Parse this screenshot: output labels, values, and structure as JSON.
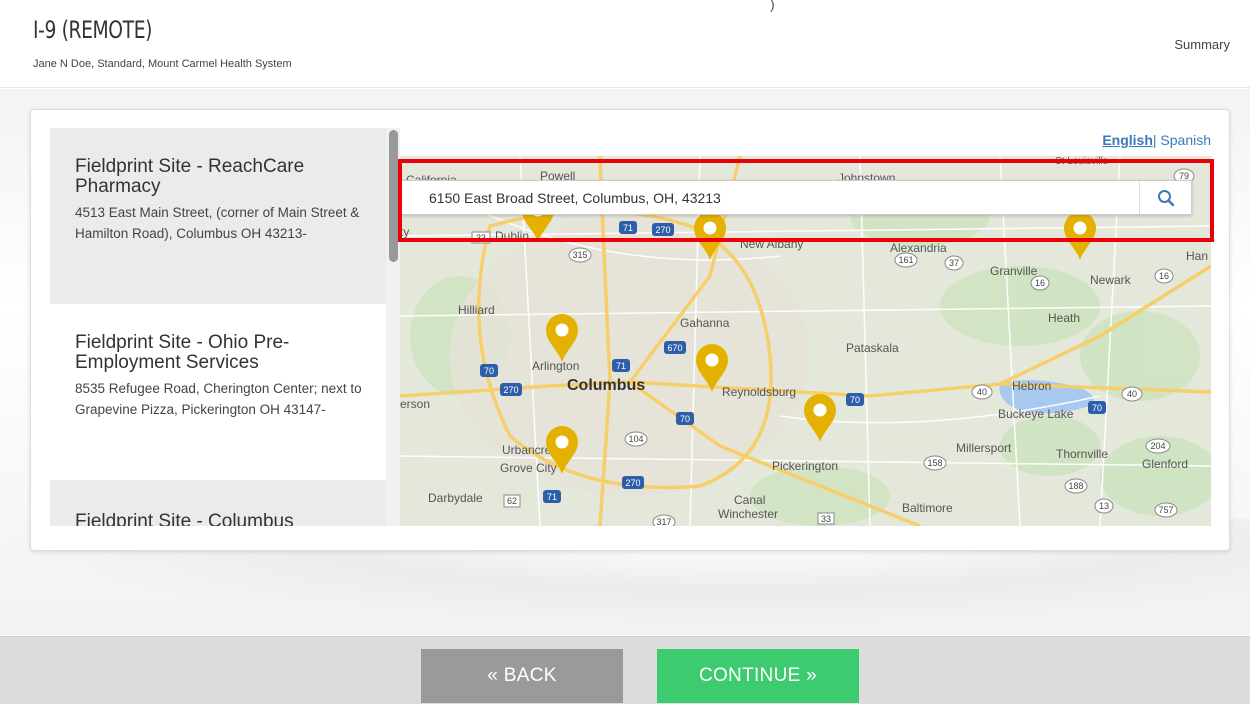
{
  "header": {
    "title": "I-9 (REMOTE)",
    "subtitle": "Jane N Doe, Standard, Mount Carmel Health System",
    "summary_link": "Summary",
    "corner_mark": ")"
  },
  "language": {
    "active": "English",
    "separator": "|",
    "other": "Spanish"
  },
  "sites": [
    {
      "name": "Fieldprint Site - ReachCare Pharmacy",
      "address": "4513 East Main Street, (corner of Main Street & Hamilton Road), Columbus OH 43213-"
    },
    {
      "name": "Fieldprint Site - Ohio Pre-Employment Services",
      "address": "8535 Refugee Road, Cherington Center; next to Grapevine Pizza, Pickerington OH 43147-"
    },
    {
      "name": "Fieldprint Site - Columbus",
      "address": ""
    }
  ],
  "search": {
    "value": "6150 East Broad Street, Columbus, OH, 43213",
    "button_icon": "search-icon"
  },
  "map": {
    "labels": {
      "california": "California",
      "powell": "Powell",
      "johnstown": "Johnstown",
      "dublin": "Dublin",
      "new_albany": "New Albany",
      "alexandria": "Alexandria",
      "granville": "Granville",
      "newark": "Newark",
      "han": "Han",
      "hilliard": "Hilliard",
      "gahanna": "Gahanna",
      "heath": "Heath",
      "arlington": "Arlington",
      "pataskala": "Pataskala",
      "columbus": "Columbus",
      "reynoldsburg": "Reynoldsburg",
      "hebron": "Hebron",
      "erson": "erson",
      "buckeye_lake": "Buckeye Lake",
      "urbancrest": "Urbancrest",
      "grove_city": "Grove City",
      "pickerington": "Pickerington",
      "millersport": "Millersport",
      "thornville": "Thornville",
      "glenford": "Glenford",
      "darbydale": "Darbydale",
      "canal": "Canal",
      "winchester": "Winchester",
      "baltimore": "Baltimore",
      "ty": "ty",
      "st_louisville": "St Louisville"
    },
    "route_shields": [
      "79",
      "33",
      "71",
      "270",
      "315",
      "161",
      "37",
      "16",
      "16",
      "670",
      "70",
      "71",
      "270",
      "70",
      "70",
      "40",
      "40",
      "70",
      "104",
      "204",
      "158",
      "270",
      "188",
      "62",
      "71",
      "13",
      "757",
      "317",
      "33"
    ],
    "marker_color": "#e5b100"
  },
  "footer": {
    "back_label": "« BACK",
    "continue_label": "CONTINUE »"
  },
  "colors": {
    "highlight": "#e8000b",
    "continue": "#3ccb6e",
    "back": "#9a9a9a",
    "link": "#3a7ab8"
  }
}
